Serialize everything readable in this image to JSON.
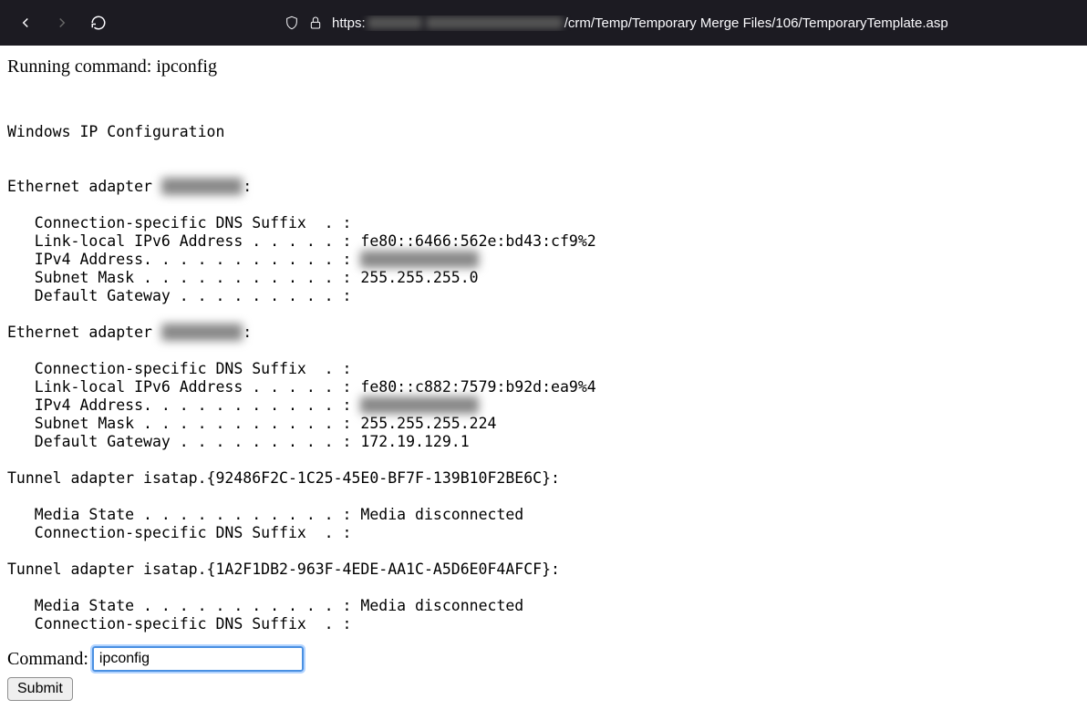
{
  "browser": {
    "url_prefix": "https:",
    "url_suffix": "/crm/Temp/Temporary Merge Files/106/TemporaryTemplate.asp"
  },
  "page": {
    "running_prefix": "Running command: ",
    "running_cmd": "ipconfig",
    "command_label": "Command: ",
    "command_value": "ipconfig",
    "submit_label": "Submit"
  },
  "output": {
    "header": "Windows IP Configuration",
    "adapters": [
      {
        "title_prefix": "Ethernet adapter ",
        "title_redacted": true,
        "rows": [
          {
            "label": "Connection-specific DNS Suffix  . :",
            "value": ""
          },
          {
            "label": "Link-local IPv6 Address . . . . . :",
            "value": " fe80::6466:562e:bd43:cf9%2"
          },
          {
            "label": "IPv4 Address. . . . . . . . . . . :",
            "value": " ███.███.██.██",
            "redacted": true
          },
          {
            "label": "Subnet Mask . . . . . . . . . . . :",
            "value": " 255.255.255.0"
          },
          {
            "label": "Default Gateway . . . . . . . . . :",
            "value": ""
          }
        ]
      },
      {
        "title_prefix": "Ethernet adapter ",
        "title_redacted": true,
        "rows": [
          {
            "label": "Connection-specific DNS Suffix  . :",
            "value": ""
          },
          {
            "label": "Link-local IPv6 Address . . . . . :",
            "value": " fe80::c882:7579:b92d:ea9%4"
          },
          {
            "label": "IPv4 Address. . . . . . . . . . . :",
            "value": " ███.██.███.██",
            "redacted": true
          },
          {
            "label": "Subnet Mask . . . . . . . . . . . :",
            "value": " 255.255.255.224"
          },
          {
            "label": "Default Gateway . . . . . . . . . :",
            "value": " 172.19.129.1"
          }
        ]
      },
      {
        "title_prefix": "Tunnel adapter isatap.{92486F2C-1C25-45E0-BF7F-139B10F2BE6C}:",
        "title_redacted": false,
        "rows": [
          {
            "label": "Media State . . . . . . . . . . . :",
            "value": " Media disconnected"
          },
          {
            "label": "Connection-specific DNS Suffix  . :",
            "value": ""
          }
        ]
      },
      {
        "title_prefix": "Tunnel adapter isatap.{1A2F1DB2-963F-4EDE-AA1C-A5D6E0F4AFCF}:",
        "title_redacted": false,
        "rows": [
          {
            "label": "Media State . . . . . . . . . . . :",
            "value": " Media disconnected"
          },
          {
            "label": "Connection-specific DNS Suffix  . :",
            "value": ""
          }
        ]
      }
    ]
  }
}
